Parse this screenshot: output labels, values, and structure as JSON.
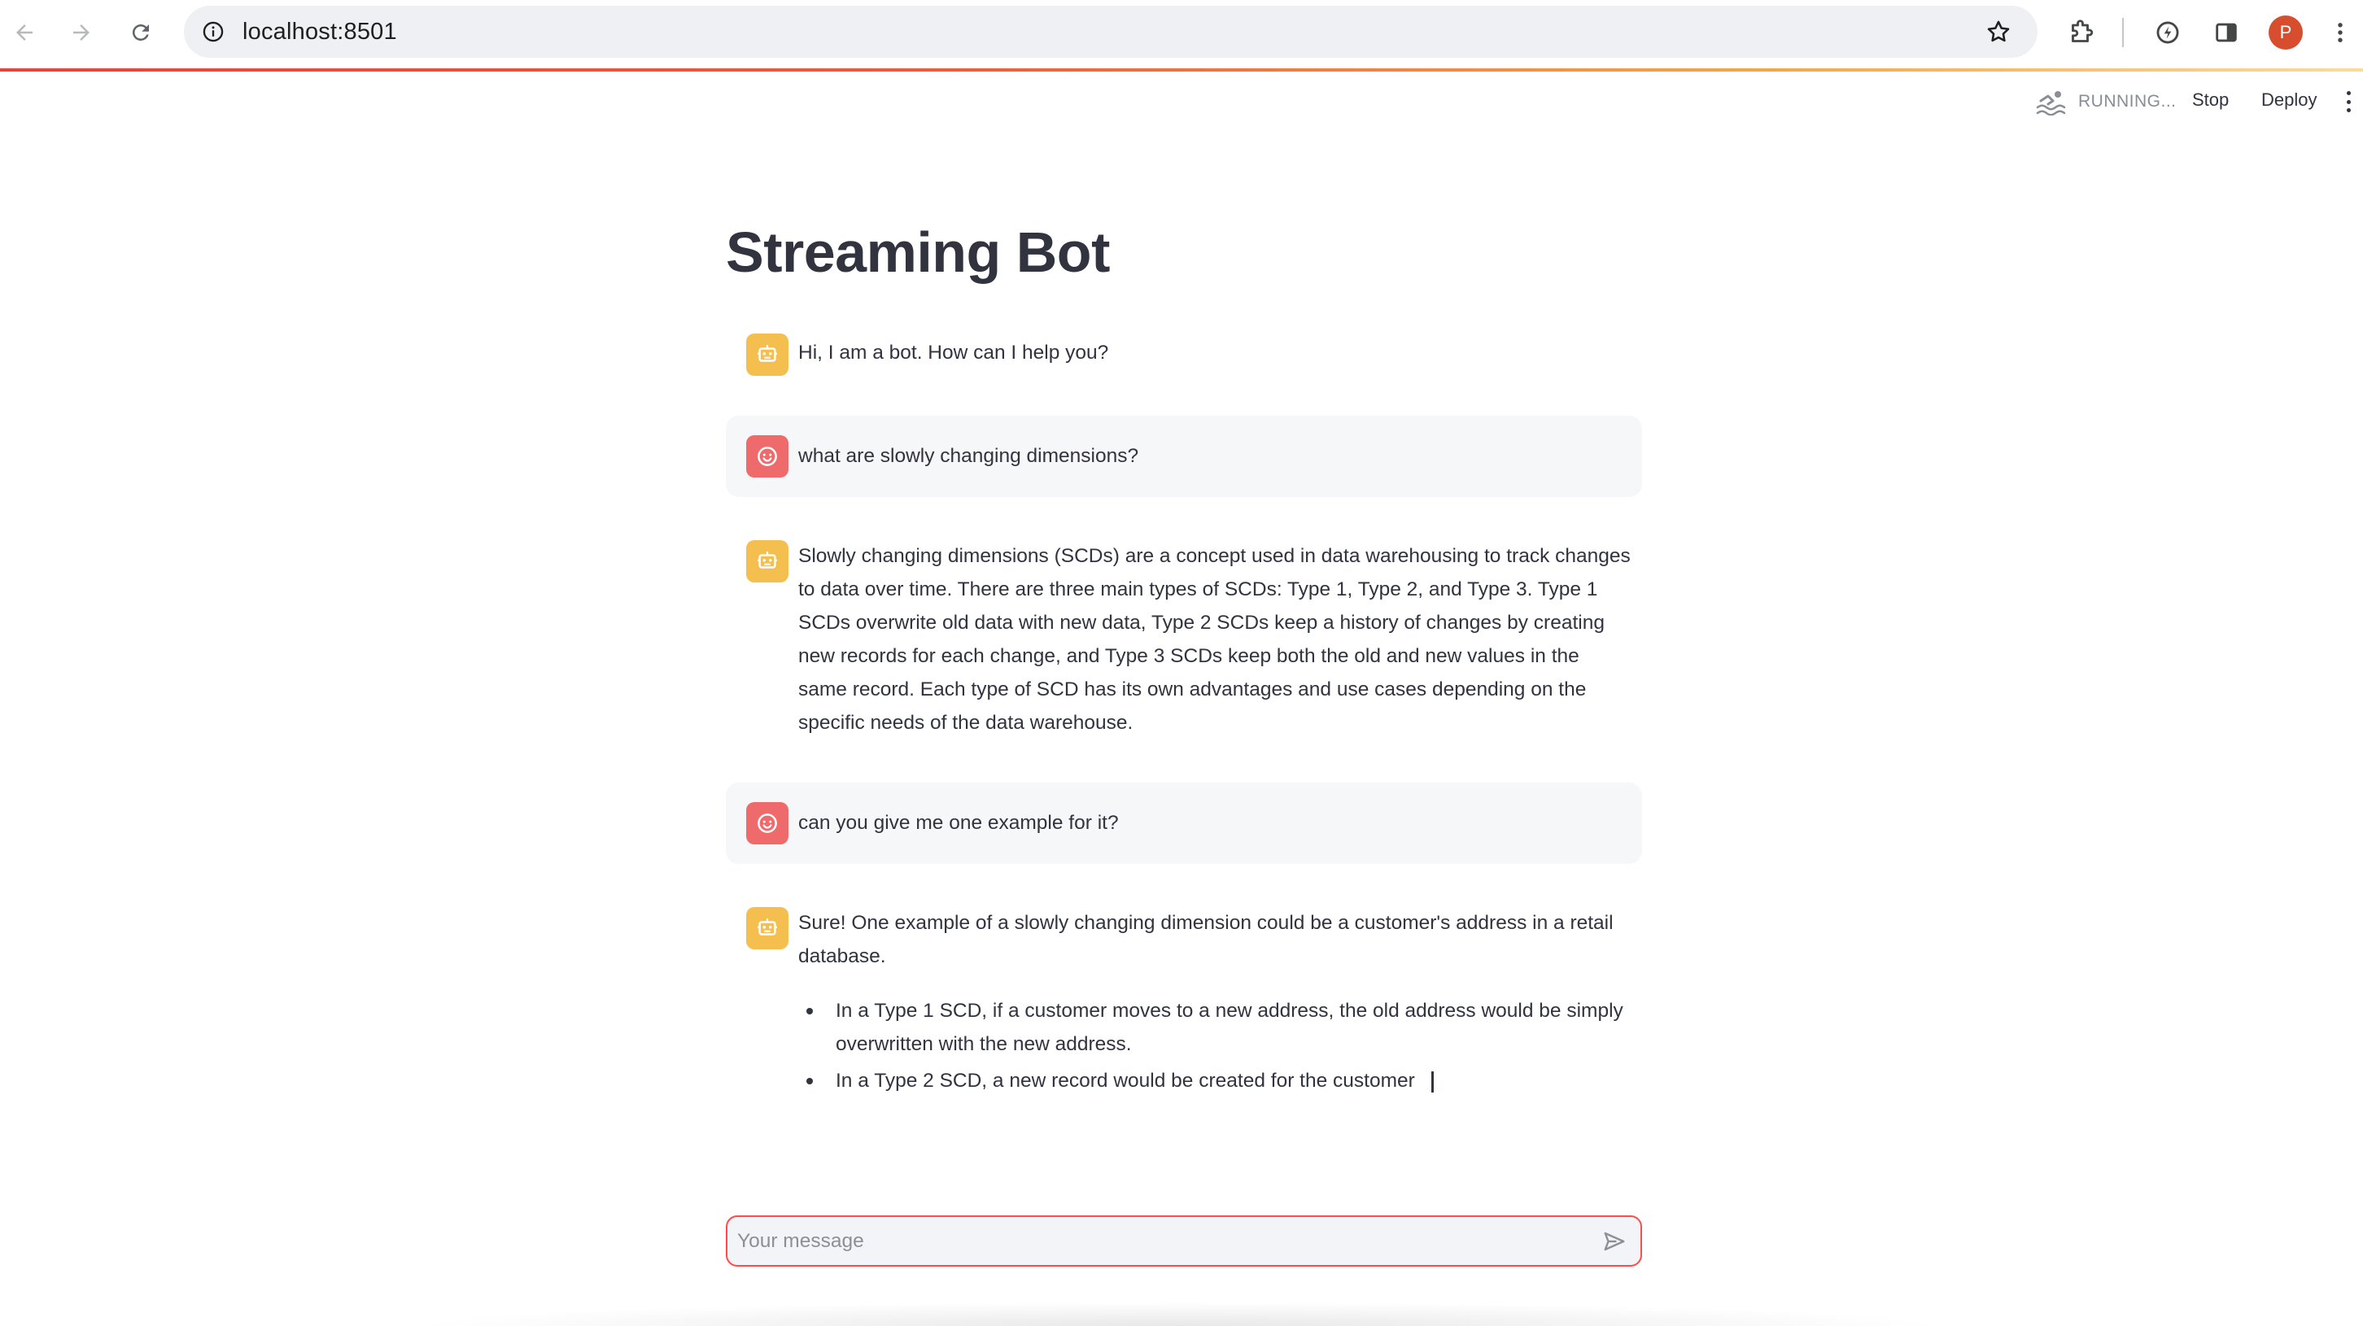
{
  "browser": {
    "url": "localhost:8501",
    "profile_initial": "P",
    "icons": [
      "back-icon",
      "forward-icon",
      "reload-icon",
      "site-info-icon",
      "bookmark-star-icon",
      "extensions-icon",
      "performance-icon",
      "side-panel-icon",
      "menu-icon"
    ]
  },
  "header": {
    "status": "RUNNING...",
    "stop_label": "Stop",
    "deploy_label": "Deploy"
  },
  "page": {
    "title": "Streaming Bot"
  },
  "messages": [
    {
      "role": "assistant",
      "text": "Hi, I am a bot. How can I help you?"
    },
    {
      "role": "user",
      "text": "what are slowly changing dimensions?"
    },
    {
      "role": "assistant",
      "text": "Slowly changing dimensions (SCDs) are a concept used in data warehousing to track changes to data over time. There are three main types of SCDs: Type 1, Type 2, and Type 3. Type 1 SCDs overwrite old data with new data, Type 2 SCDs keep a history of changes by creating new records for each change, and Type 3 SCDs keep both the old and new values in the same record. Each type of SCD has its own advantages and use cases depending on the specific needs of the data warehouse."
    },
    {
      "role": "user",
      "text": "can you give me one example for it?"
    },
    {
      "role": "assistant",
      "text": "Sure! One example of a slowly changing dimension could be a customer's address in a retail database.",
      "bullets": [
        "In a Type 1 SCD, if a customer moves to a new address, the old address would be simply overwritten with the new address.",
        "In a Type 2 SCD, a new record would be created for the customer"
      ]
    }
  ],
  "chat_input": {
    "placeholder": "Your message",
    "value": ""
  },
  "colors": {
    "accent": "#ff4b4b",
    "bot_avatar": "#f5bf4f",
    "user_avatar": "#ef6b6b",
    "text": "#31333f"
  }
}
